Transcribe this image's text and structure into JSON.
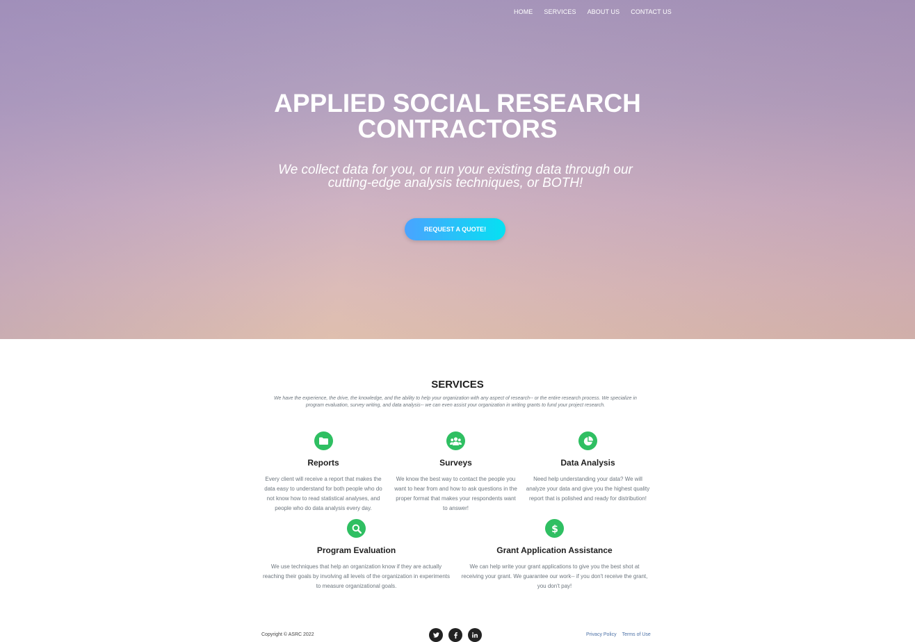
{
  "nav": {
    "items": [
      "HOME",
      "SERVICES",
      "ABOUT US",
      "CONTACT US"
    ]
  },
  "hero": {
    "title_line1": "APPLIED SOCIAL RESEARCH",
    "title_line2": "CONTRACTORS",
    "subtitle": "We collect data for you, or run your existing data through our cutting-edge analysis techniques, or BOTH!",
    "cta_label": "REQUEST A QUOTE!"
  },
  "services": {
    "title": "SERVICES",
    "description": "We have the experience, the drive, the knowledge, and the ability to help your organization with any aspect of research-- or the entire research process. We specialize in program evaluation, survey writing, and data analysis-- we can even assist your organization in writing grants to fund your project research.",
    "items": [
      {
        "icon": "folder-icon",
        "name": "Reports",
        "text": "Every client will receive a report that makes the data easy to understand for both people who do not know how to read statistical analyses, and people who do data analysis every day."
      },
      {
        "icon": "users-icon",
        "name": "Surveys",
        "text": "We know the best way to contact the people you want to hear from and how to ask questions in the proper format that makes your respondents want to answer!"
      },
      {
        "icon": "pie-chart-icon",
        "name": "Data Analysis",
        "text": "Need help understanding your data? We will analyze your data and give you the highest quality report that is polished and ready for distribution!"
      },
      {
        "icon": "search-icon",
        "name": "Program Evaluation",
        "text": "We use techniques that help an organization know if they are actually reaching their goals by involving all levels of the organization in experiments to measure organizational goals."
      },
      {
        "icon": "dollar-icon",
        "name": "Grant Application Assistance",
        "text": "We can help write your grant applications to give you the best shot at receiving your grant. We guarantee our work-- if you don't receive the grant, you don't pay!"
      }
    ]
  },
  "footer": {
    "copyright": "Copyright © ASRC 2022",
    "social": [
      "twitter-icon",
      "facebook-icon",
      "linkedin-icon"
    ],
    "links": [
      "Privacy Policy",
      "Terms of Use"
    ]
  },
  "colors": {
    "accent_green": "#2fbf62",
    "cta_gradient_start": "#4aa3ff",
    "cta_gradient_end": "#05e1f2"
  }
}
